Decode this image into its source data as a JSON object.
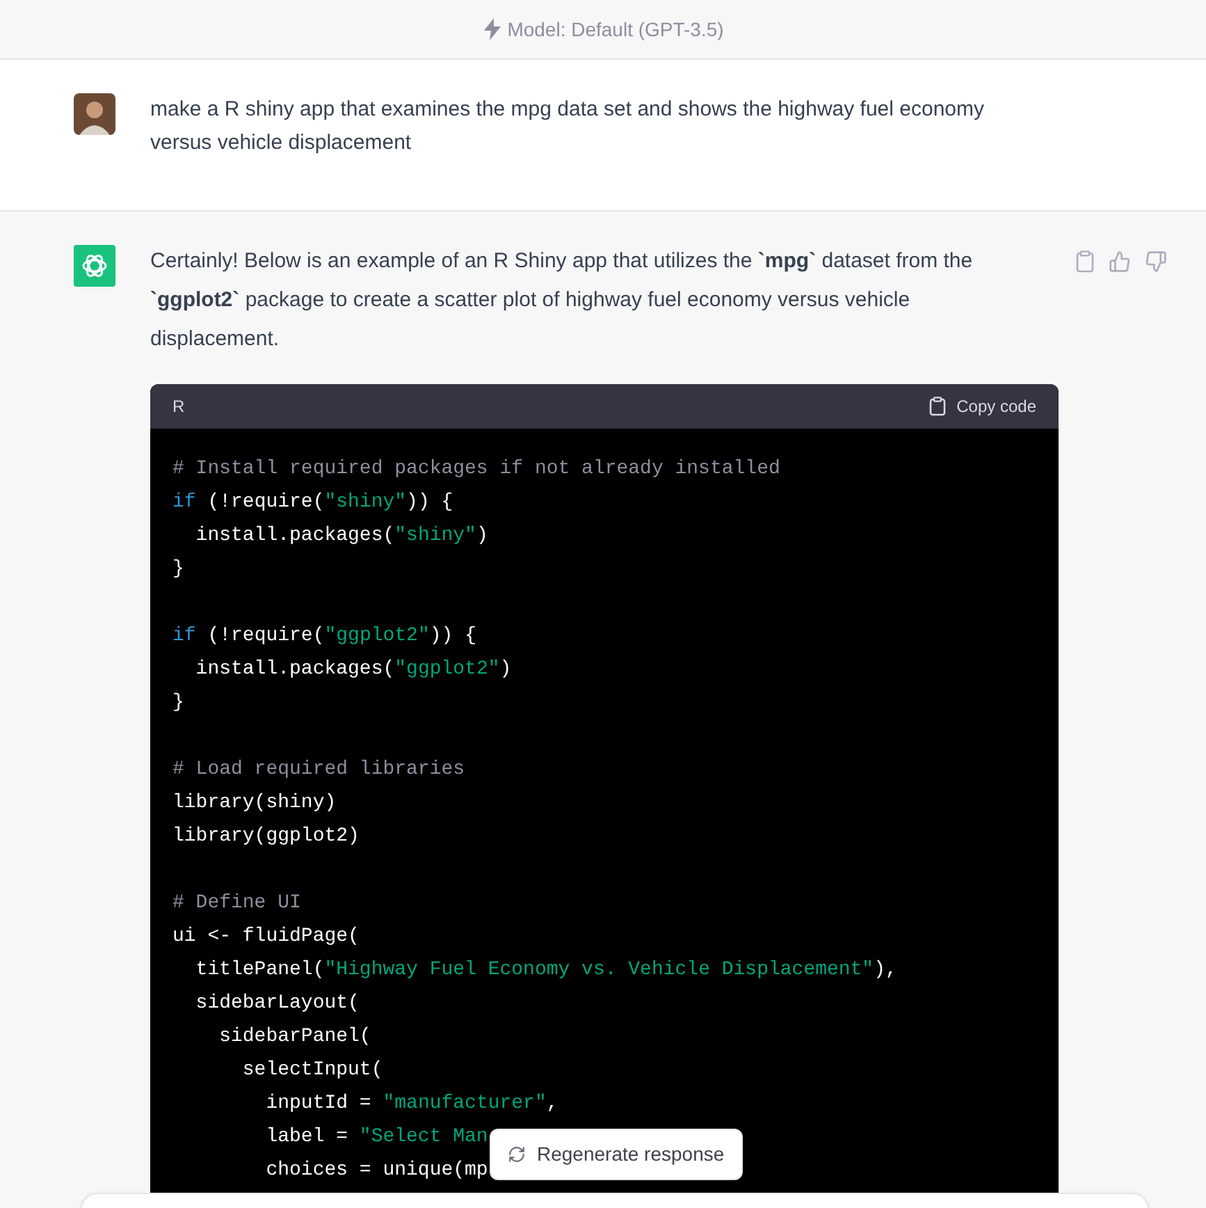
{
  "header": {
    "model_label": "Model: Default (GPT-3.5)"
  },
  "user_message": {
    "text": "make a R shiny app that examines the mpg data set and shows the highway fuel economy versus vehicle displacement"
  },
  "assistant_message": {
    "intro": "Certainly! Below is an example of an R Shiny app that utilizes the **`mpg`** dataset from the **`ggplot2`** package to create a scatter plot of highway fuel economy versus vehicle displacement.",
    "code_block": {
      "language": "R",
      "copy_label": "Copy code",
      "lines": [
        [
          {
            "kind": "comment",
            "text": "# Install required packages if not already installed"
          }
        ],
        [
          {
            "kind": "keyword",
            "text": "if"
          },
          {
            "kind": "plain",
            "text": " (!require("
          },
          {
            "kind": "string",
            "text": "\"shiny\""
          },
          {
            "kind": "plain",
            "text": ")) {"
          }
        ],
        [
          {
            "kind": "plain",
            "text": "  install.packages("
          },
          {
            "kind": "string",
            "text": "\"shiny\""
          },
          {
            "kind": "plain",
            "text": ")"
          }
        ],
        [
          {
            "kind": "plain",
            "text": "}"
          }
        ],
        [
          {
            "kind": "blank"
          }
        ],
        [
          {
            "kind": "keyword",
            "text": "if"
          },
          {
            "kind": "plain",
            "text": " (!require("
          },
          {
            "kind": "string",
            "text": "\"ggplot2\""
          },
          {
            "kind": "plain",
            "text": ")) {"
          }
        ],
        [
          {
            "kind": "plain",
            "text": "  install.packages("
          },
          {
            "kind": "string",
            "text": "\"ggplot2\""
          },
          {
            "kind": "plain",
            "text": ")"
          }
        ],
        [
          {
            "kind": "plain",
            "text": "}"
          }
        ],
        [
          {
            "kind": "blank"
          }
        ],
        [
          {
            "kind": "comment",
            "text": "# Load required libraries"
          }
        ],
        [
          {
            "kind": "plain",
            "text": "library(shiny)"
          }
        ],
        [
          {
            "kind": "plain",
            "text": "library(ggplot2)"
          }
        ],
        [
          {
            "kind": "blank"
          }
        ],
        [
          {
            "kind": "comment",
            "text": "# Define UI"
          }
        ],
        [
          {
            "kind": "plain",
            "text": "ui <- fluidPage("
          }
        ],
        [
          {
            "kind": "plain",
            "text": "  titlePanel("
          },
          {
            "kind": "string",
            "text": "\"Highway Fuel Economy vs. Vehicle Displacement\""
          },
          {
            "kind": "plain",
            "text": "),"
          }
        ],
        [
          {
            "kind": "plain",
            "text": "  sidebarLayout("
          }
        ],
        [
          {
            "kind": "plain",
            "text": "    sidebarPanel("
          }
        ],
        [
          {
            "kind": "plain",
            "text": "      selectInput("
          }
        ],
        [
          {
            "kind": "plain",
            "text": "        inputId = "
          },
          {
            "kind": "string",
            "text": "\"manufacturer\""
          },
          {
            "kind": "plain",
            "text": ","
          }
        ],
        [
          {
            "kind": "plain",
            "text": "        label = "
          },
          {
            "kind": "string",
            "text": "\"Select Man"
          }
        ],
        [
          {
            "kind": "plain",
            "text": "        choices = unique(mp"
          }
        ]
      ]
    }
  },
  "regenerate_button": {
    "label": "Regenerate response"
  }
}
